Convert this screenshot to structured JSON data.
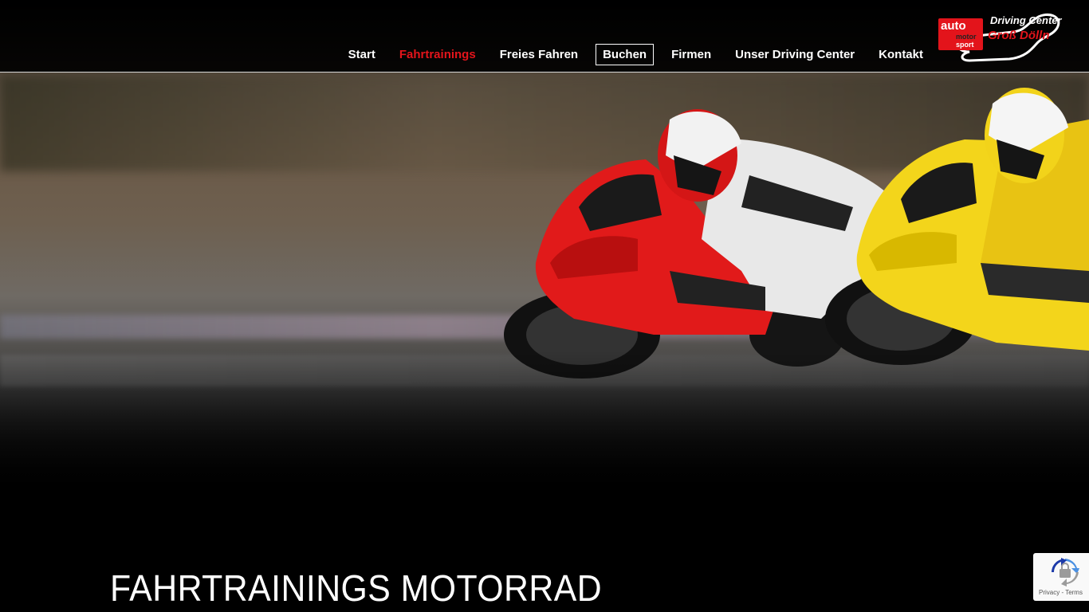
{
  "nav": {
    "items": [
      {
        "label": "Start",
        "state": "normal"
      },
      {
        "label": "Fahrtrainings",
        "state": "active"
      },
      {
        "label": "Freies Fahren",
        "state": "normal"
      },
      {
        "label": "Buchen",
        "state": "boxed"
      },
      {
        "label": "Firmen",
        "state": "normal"
      },
      {
        "label": "Unser Driving Center",
        "state": "normal"
      },
      {
        "label": "Kontakt",
        "state": "normal"
      }
    ]
  },
  "logo": {
    "brand_line1": "auto",
    "brand_line2": "motor",
    "brand_line3": "sport",
    "title_line1": "Driving Center",
    "title_line2": "Groß Dölln"
  },
  "hero": {
    "image_icon": "motorcycle-racing-photo"
  },
  "page": {
    "title": "FAHRTRAININGS MOTORRAD"
  },
  "recaptcha": {
    "links": "Privacy - Terms"
  },
  "colors": {
    "accent": "#e3141b",
    "background": "#000000",
    "nav_text": "#ffffff"
  }
}
